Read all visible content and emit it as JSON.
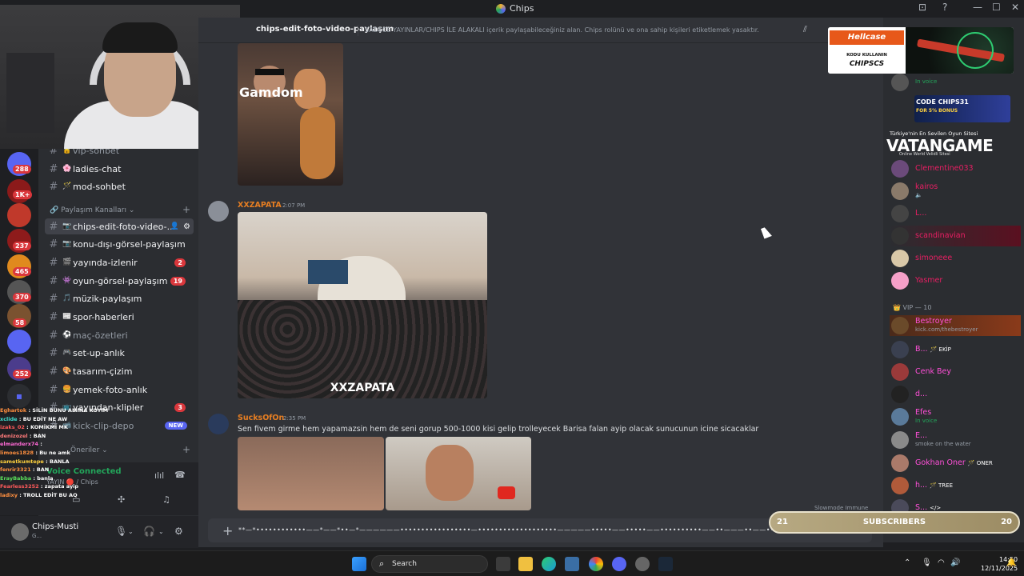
{
  "window": {
    "title": "Chips",
    "minimize": "—",
    "maximize": "☐",
    "close": "✕"
  },
  "servers": [
    {
      "badge": "288",
      "color": "#5865f2"
    },
    {
      "badge": "1K+",
      "color": "#8b1a1a"
    },
    {
      "badge": "",
      "color": "#c0392b"
    },
    {
      "badge": "237",
      "color": "#8e1b1b"
    },
    {
      "badge": "465",
      "color": "#e08a1e"
    },
    {
      "badge": "370",
      "color": "#555"
    },
    {
      "badge": "58",
      "color": "#7a5230"
    },
    {
      "badge": "",
      "color": "#5865f2"
    },
    {
      "badge": "252",
      "color": "#4b3c8c"
    }
  ],
  "channels": {
    "top": [
      {
        "emoji": "🔒",
        "name": "vip-sohbet",
        "state": "dim"
      },
      {
        "emoji": "🌸",
        "name": "ladies-chat",
        "state": "unread"
      },
      {
        "emoji": "🪄",
        "name": "mod-sohbet",
        "state": "unread"
      }
    ],
    "category": "Paylaşım Kanalları",
    "list": [
      {
        "emoji": "📷",
        "name": "chips-edit-foto-video-...",
        "state": "active",
        "badge": ""
      },
      {
        "emoji": "📷",
        "name": "konu-dışı-görsel-paylaşım",
        "state": "unread",
        "badge": ""
      },
      {
        "emoji": "🎬",
        "name": "yayında-izlenir",
        "state": "unread",
        "badge": "2"
      },
      {
        "emoji": "👾",
        "name": "oyun-görsel-paylaşım",
        "state": "unread",
        "badge": "19"
      },
      {
        "emoji": "🎵",
        "name": "müzik-paylaşım",
        "state": "unread",
        "badge": ""
      },
      {
        "emoji": "📰",
        "name": "spor-haberleri",
        "state": "unread",
        "badge": ""
      },
      {
        "emoji": "⚽",
        "name": "maç-özetleri",
        "state": "dim",
        "badge": ""
      },
      {
        "emoji": "🎮",
        "name": "set-up-anlık",
        "state": "unread",
        "badge": ""
      },
      {
        "emoji": "🎨",
        "name": "tasarım-çizim",
        "state": "unread",
        "badge": ""
      },
      {
        "emoji": "🍔",
        "name": "yemek-foto-anlık",
        "state": "unread",
        "badge": ""
      },
      {
        "emoji": "📺",
        "name": "yayından-klipler",
        "state": "unread",
        "badge": "3"
      },
      {
        "emoji": "📹",
        "name": "kick-clip-depo",
        "state": "dim",
        "badge": "NEW"
      }
    ],
    "suggestions": "Öneriler"
  },
  "stream_chat": [
    {
      "user": "Eghartok",
      "text": "SİLİN BUNU AMINA KOYIM",
      "color": "#ff8f3f"
    },
    {
      "user": "xclide",
      "text": "BU EDİT NE AW",
      "color": "#40e0d0"
    },
    {
      "user": "izaks_02",
      "text": "KOMİKMİ MK",
      "color": "#ff5a5a"
    },
    {
      "user": "denizozel",
      "text": "BAN",
      "color": "#ff7a7a"
    },
    {
      "user": "elmanderx74",
      "text": "",
      "color": "#ff6ad5"
    },
    {
      "user": "limoes1828",
      "text": "Bu ne amk",
      "color": "#ff8f3f"
    },
    {
      "user": "sametkumtepe",
      "text": "BANLA",
      "color": "#ffd23f"
    },
    {
      "user": "fenrir3321",
      "text": "BAN",
      "color": "#ff8f3f"
    },
    {
      "user": "ErayBabba",
      "text": "banla",
      "color": "#5ae05a"
    },
    {
      "user": "Fearless3252",
      "text": "zapata ayip",
      "color": "#ff5a5a"
    },
    {
      "user": "ladixy",
      "text": "TROLL EDİT BU AQ",
      "color": "#ff8f3f"
    }
  ],
  "voice_panel": {
    "status": "Voice Connected",
    "sub": "YAYIN 🔴 / Chips"
  },
  "user_panel": {
    "username": "Chips-Musti",
    "status": "G..."
  },
  "header": {
    "channel": "chips-edit-foto-video-paylaşım",
    "topic": "SADECE YAYINLAR/CHIPS İLE ALAKALI içerik paylaşabileceğiniz alan. Chips rolünü ve ona sahip kişileri etiketlemek yasaktır."
  },
  "messages": [
    {
      "user": "",
      "time": "",
      "text": "",
      "image_caption": "Gamdom"
    },
    {
      "user": "XXZAPATA",
      "time": "2:07 PM",
      "text": "",
      "image_caption": "XXZAPATA"
    },
    {
      "user": "SucksOfOn",
      "time": "2:35 PM",
      "text": "Sen fivem girme hem yapamazsin hem de seni gorup 500-1000 kisi gelip trolleyecek Barisa falan ayip olacak sunucunun icine sicacaklar"
    }
  ],
  "composer": {
    "text": "**—*••••••••••••——*——*••—*——————•••••••••••••••••—•••••••••••••••••••—————•••••——•••••——••••••••••——••———••——•••••••••••••—•••••—•••"
  },
  "slowmode": "Slowmode Immune",
  "members": {
    "top": [
      {
        "name": "",
        "sub": "In voice",
        "color": "#949ba4"
      },
      {
        "name": "Clementine033",
        "sub": "",
        "color": "#e91e63"
      },
      {
        "name": "kairos",
        "sub": "🔈",
        "color": "#e91e63"
      },
      {
        "name": "L...",
        "sub": "",
        "color": "#e91e63"
      },
      {
        "name": "scandinavian",
        "sub": "",
        "color": "#e91e63"
      },
      {
        "name": "simoneee",
        "sub": "",
        "color": "#e91e63"
      },
      {
        "name": "Yasmer",
        "sub": "",
        "color": "#e91e63"
      }
    ],
    "vip_category": "VIP — 10",
    "vip": [
      {
        "name": "Bestroyer",
        "sub": "kick.com/thebestroyer",
        "color": "#ff4fd8",
        "tag": ""
      },
      {
        "name": "B...",
        "sub": "",
        "color": "#ff4fd8",
        "tag": "🪄 EKİP"
      },
      {
        "name": "Cenk Bey",
        "sub": "",
        "color": "#ff4fd8",
        "tag": ""
      },
      {
        "name": "d...",
        "sub": "",
        "color": "#ff4fd8",
        "tag": ""
      },
      {
        "name": "Efes",
        "sub": "In voice",
        "color": "#ff4fd8",
        "tag": ""
      },
      {
        "name": "E...",
        "sub": "smoke on the water",
        "color": "#ff4fd8",
        "tag": ""
      },
      {
        "name": "Gokhan Oner",
        "sub": "",
        "color": "#ff4fd8",
        "tag": "🪄 ONER"
      },
      {
        "name": "h...",
        "sub": "",
        "color": "#ff4fd8",
        "tag": "🪄 TREE"
      },
      {
        "name": "S...",
        "sub": "",
        "color": "#ff4fd8",
        "tag": "</>"
      }
    ]
  },
  "sponsors": {
    "hellcase": {
      "brand": "Hellcase",
      "line1": "KODU KULLANIN",
      "line2": "CHIPSCS"
    },
    "lootbox": {
      "line1": "CODE CHIPS31",
      "line2": "FOR 5% BONUS"
    },
    "vatan": {
      "tagline": "Türkiye'nin En Sevilen Oyun Sitesi",
      "name": "VATANGAME",
      "sub": "Online World Velidli Sitesi"
    }
  },
  "subscribers": {
    "left": "21",
    "label": "SUBSCRIBERS",
    "right": "20"
  },
  "taskbar": {
    "search": "Search",
    "time": "14:50",
    "date": "12/11/2025"
  }
}
